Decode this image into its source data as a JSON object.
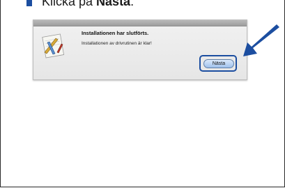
{
  "instruction": {
    "prefix": "Klicka på ",
    "target": "Nästa",
    "suffix": "."
  },
  "dialog": {
    "heading": "Installationen har slutförts.",
    "message": "Installationen av drivrutinen är klar!",
    "next_button": "Nästa"
  },
  "colors": {
    "accent": "#1c4ea0"
  },
  "icons": {
    "installer": "installer-icon",
    "pointer": "pointer-arrow-icon"
  }
}
